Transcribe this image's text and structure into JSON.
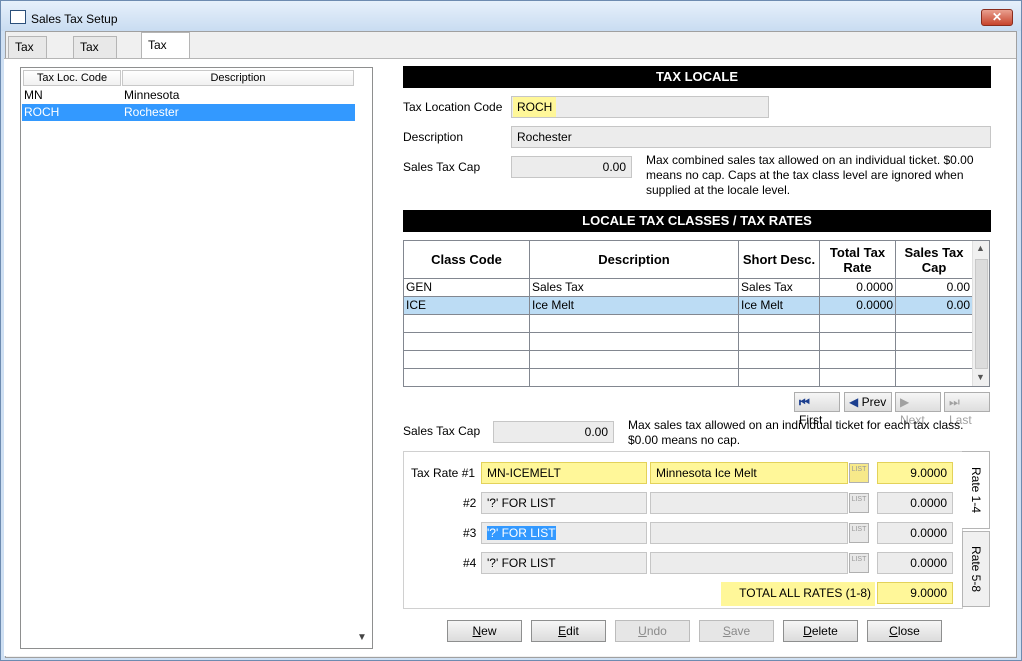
{
  "window": {
    "title": "Sales Tax Setup",
    "close_label": "✕"
  },
  "tabs": [
    {
      "label": "Tax Rate"
    },
    {
      "label": "Tax Class"
    },
    {
      "label": "Tax Locale"
    }
  ],
  "left_list": {
    "headers": [
      "Tax Loc. Code",
      "Description"
    ],
    "rows": [
      {
        "code": "MN",
        "description": "Minnesota"
      },
      {
        "code": "ROCH",
        "description": "Rochester"
      }
    ],
    "selected_index": 1
  },
  "tax_locale": {
    "header": "TAX LOCALE",
    "location_code_label": "Tax Location Code",
    "location_code_value": "ROCH",
    "description_label": "Description",
    "description_value": "Rochester",
    "cap_label": "Sales Tax Cap",
    "cap_value": "0.00",
    "cap_note": "Max combined sales tax allowed on an individual ticket.  $0.00 means no cap.  Caps at the tax class level are ignored when supplied at the locale level."
  },
  "classes": {
    "header": "LOCALE TAX CLASSES / TAX RATES",
    "columns": [
      "Class Code",
      "Description",
      "Short Desc.",
      "Total Tax Rate",
      "Sales Tax Cap"
    ],
    "rows": [
      {
        "code": "GEN",
        "description": "Sales Tax",
        "short": "Sales Tax",
        "rate": "0.0000",
        "cap": "0.00"
      },
      {
        "code": "ICE",
        "description": "Ice Melt",
        "short": "Ice Melt",
        "rate": "0.0000",
        "cap": "0.00"
      }
    ],
    "selected_index": 1
  },
  "nav": {
    "first": "First",
    "prev": "Prev",
    "next": "Next",
    "last": "Last"
  },
  "class_cap": {
    "label": "Sales Tax Cap",
    "value": "0.00",
    "note": "Max sales tax allowed on an individual ticket for each tax class.  $0.00 means no cap."
  },
  "rates": {
    "rate1_label": "Tax Rate #1",
    "rate2_label": "#2",
    "rate3_label": "#3",
    "rate4_label": "#4",
    "rows": [
      {
        "code": "MN-ICEMELT",
        "description": "Minnesota Ice Melt",
        "value": "9.0000"
      },
      {
        "code": "'?' FOR LIST",
        "description": "",
        "value": "0.0000"
      },
      {
        "code": "'?' FOR LIST",
        "description": "",
        "value": "0.0000"
      },
      {
        "code": "'?' FOR LIST",
        "description": "",
        "value": "0.0000"
      }
    ],
    "total_label": "TOTAL ALL RATES (1-8)",
    "total_value": "9.0000",
    "tab1": "Rate 1-4",
    "tab2": "Rate 5-8",
    "list_icon_label": "LIST"
  },
  "buttons": {
    "new": "New",
    "edit": "Edit",
    "undo": "Undo",
    "save": "Save",
    "delete": "Delete",
    "close": "Close"
  },
  "colors": {
    "highlight": "#fff799",
    "selection": "#3399ff",
    "grid_selection": "#bcdcf4"
  }
}
